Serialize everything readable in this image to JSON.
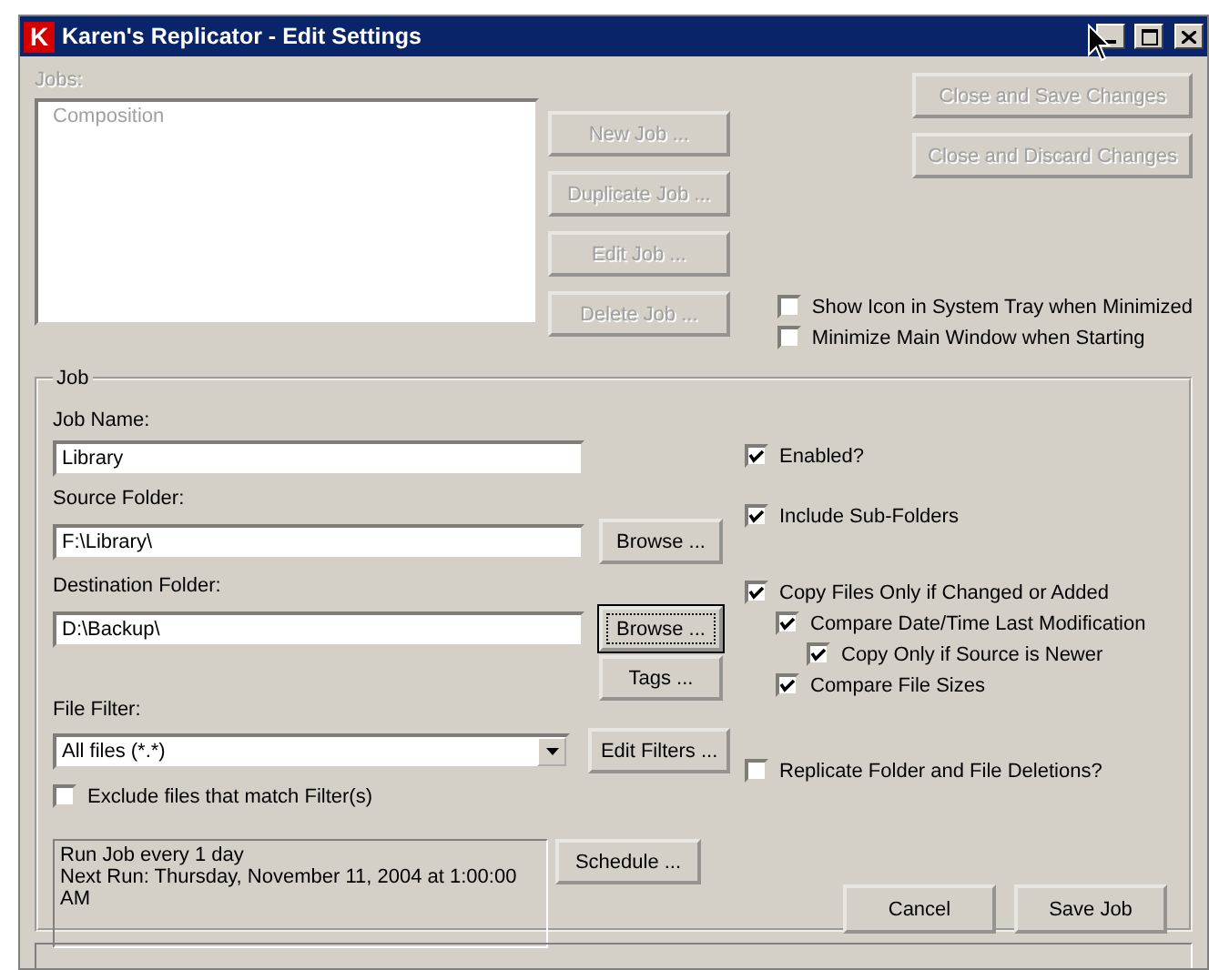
{
  "window": {
    "title": "Karen's Replicator - Edit Settings",
    "app_icon": "K"
  },
  "jobs": {
    "label": "Jobs:",
    "disabled": true,
    "items": [
      {
        "label": "Composition",
        "selected": false
      }
    ]
  },
  "job_buttons": [
    {
      "label": "New Job ...",
      "disabled": true
    },
    {
      "label": "Duplicate Job ...",
      "disabled": true
    },
    {
      "label": "Edit Job ...",
      "disabled": true
    },
    {
      "label": "Delete Job ...",
      "disabled": true
    }
  ],
  "close_buttons": [
    {
      "label": "Close and Save Changes",
      "disabled": true
    },
    {
      "label": "Close and Discard Changes",
      "disabled": true
    }
  ],
  "options": [
    {
      "label": "Show Icon in System Tray when Minimized",
      "checked": false
    },
    {
      "label": "Minimize Main Window when Starting",
      "checked": false
    }
  ],
  "job": {
    "title": "Job",
    "job_name": {
      "label": "Job Name:",
      "value": "Library"
    },
    "source_folder": {
      "label": "Source Folder:",
      "value": "F:\\Library\\",
      "button": {
        "label": "Browse ...",
        "focused": false
      }
    },
    "destination_folder": {
      "label": "Destination Folder:",
      "value": "D:\\Backup\\",
      "button": {
        "label": "Browse ...",
        "focused": true
      }
    },
    "tags_button": "Tags ...",
    "file_filter": {
      "label": "File Filter:",
      "value": "All files (*.*)",
      "button": "Edit Filters ..."
    },
    "exclude": {
      "label": "Exclude files that match Filter(s)",
      "checked": false
    },
    "schedule": {
      "lines": [
        "Run Job every 1 day",
        "Next Run: Thursday, November 11, 2004 at 1:00:00",
        "AM"
      ],
      "button": "Schedule ..."
    },
    "checks": [
      {
        "label": "Enabled?",
        "checked": true
      },
      {
        "label": "Include Sub-Folders",
        "checked": true
      },
      {
        "label": "Copy Files Only if Changed or Added",
        "checked": true,
        "children": [
          {
            "label": "Compare Date/Time Last Modification",
            "checked": true,
            "children": [
              {
                "label": "Copy Only if Source is Newer",
                "checked": true
              }
            ]
          },
          {
            "label": "Compare File Sizes",
            "checked": true
          }
        ]
      },
      {
        "label": "Replicate Folder and File Deletions?",
        "checked": false
      }
    ],
    "buttons": [
      "Cancel",
      "Save Job"
    ]
  }
}
